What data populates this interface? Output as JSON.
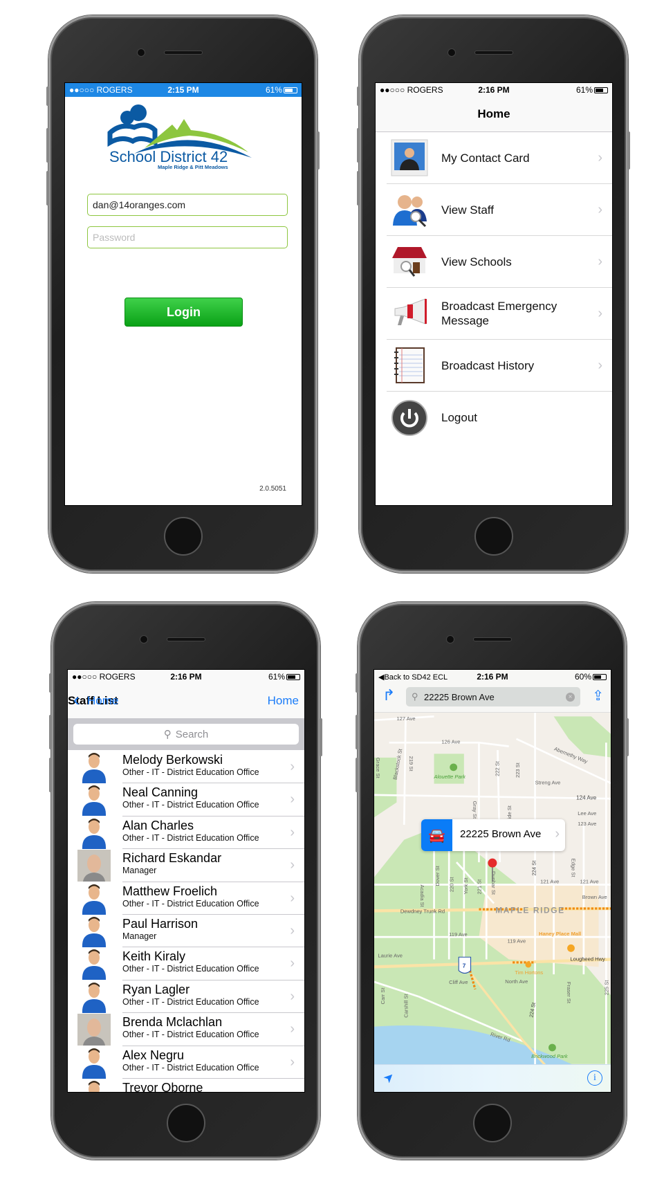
{
  "status_login": {
    "carrier": "●●○○○ ROGERS",
    "time": "2:15 PM",
    "battery": "61%"
  },
  "status_home": {
    "carrier": "●●○○○ ROGERS",
    "time": "2:16 PM",
    "battery": "61%"
  },
  "status_staff": {
    "carrier": "●●○○○ ROGERS",
    "time": "2:16 PM",
    "battery": "61%"
  },
  "status_map": {
    "back": "◀Back to SD42 ECL",
    "time": "2:16 PM",
    "battery": "60%"
  },
  "login": {
    "logo_title": "School District 42",
    "logo_subtitle": "Maple Ridge & Pitt Meadows",
    "email_value": "dan@14oranges.com",
    "password_placeholder": "Password",
    "login_label": "Login",
    "version": "2.0.5051",
    "accent": "#1e88e5"
  },
  "home": {
    "title": "Home",
    "items": [
      {
        "label": "My Contact Card",
        "icon": "contact-card-icon"
      },
      {
        "label": "View Staff",
        "icon": "staff-search-icon"
      },
      {
        "label": "View Schools",
        "icon": "school-search-icon"
      },
      {
        "label": "Broadcast Emergency Message",
        "icon": "megaphone-icon"
      },
      {
        "label": "Broadcast History",
        "icon": "notebook-icon"
      },
      {
        "label": "Logout",
        "icon": "power-icon"
      }
    ]
  },
  "staff": {
    "back_label": "Home",
    "title": "Staff List",
    "right_label": "Home",
    "search_placeholder": "Search",
    "rows": [
      {
        "name": "Melody Berkowski",
        "dept": "Other - IT - District Education Office",
        "avatar": "generic"
      },
      {
        "name": "Neal Canning",
        "dept": "Other - IT - District Education Office",
        "avatar": "generic"
      },
      {
        "name": "Alan Charles",
        "dept": "Other - IT - District Education Office",
        "avatar": "generic"
      },
      {
        "name": "Richard Eskandar",
        "dept": "Manager",
        "avatar": "photo"
      },
      {
        "name": "Matthew Froelich",
        "dept": "Other - IT - District Education Office",
        "avatar": "generic"
      },
      {
        "name": "Paul Harrison",
        "dept": "Manager",
        "avatar": "generic"
      },
      {
        "name": "Keith Kiraly",
        "dept": "Other - IT - District Education Office",
        "avatar": "generic"
      },
      {
        "name": "Ryan Lagler",
        "dept": "Other - IT - District Education Office",
        "avatar": "generic"
      },
      {
        "name": "Brenda Mclachlan",
        "dept": "Other - IT - District Education Office",
        "avatar": "photo"
      },
      {
        "name": "Alex Negru",
        "dept": "Other - IT - District Education Office",
        "avatar": "generic"
      },
      {
        "name": "Trevor Oborne",
        "dept": "",
        "avatar": "generic"
      }
    ]
  },
  "map": {
    "search_value": "22225 Brown Ave",
    "callout": "22225 Brown Ave",
    "city": "MAPLE RIDGE",
    "highway": "7",
    "labels": [
      "127 Ave",
      "126 Ave",
      "Abernethy Way",
      "Alouette Park",
      "Streng Ave",
      "124 Ave",
      "Lee Ave",
      "123 Ave",
      "Grace St",
      "Blackstock St",
      "219 St",
      "222 St",
      "223 St",
      "Gray St",
      "ide St",
      "Dover St",
      "220 St",
      "York St",
      "221 St",
      "Dunbar St",
      "224 St",
      "Edge St",
      "Acadia St",
      "121 Ave",
      "121 Ave",
      "Brown Ave",
      "Dewdney Trunk Rd",
      "119 Ave",
      "119 Ave",
      "Haney Place Mall",
      "Laurie Ave",
      "Lougheed Hwy",
      "Tim Hortons",
      "North Ave",
      "Cliff Ave",
      "Carr St",
      "Carshill St",
      "224 St",
      "Fraser St",
      "225 St",
      "River Rd",
      "Brickwood Park"
    ]
  }
}
